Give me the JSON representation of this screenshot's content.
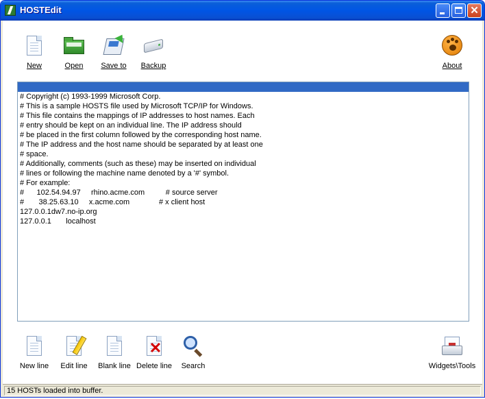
{
  "window": {
    "title": "HOSTEdit"
  },
  "toolbar": {
    "new": {
      "label": "New",
      "icon": "new-file-icon"
    },
    "open": {
      "label": "Open",
      "icon": "open-folder-icon"
    },
    "save_to": {
      "label": "Save to",
      "icon": "save-disk-icon"
    },
    "backup": {
      "label": "Backup",
      "icon": "backup-drive-icon"
    },
    "about": {
      "label": "About",
      "icon": "about-paw-icon"
    }
  },
  "editor": {
    "lines": [
      "",
      "# Copyright (c) 1993-1999 Microsoft Corp.",
      "# This is a sample HOSTS file used by Microsoft TCP/IP for Windows.",
      "# This file contains the mappings of IP addresses to host names. Each",
      "# entry should be kept on an individual line. The IP address should",
      "# be placed in the first column followed by the corresponding host name.",
      "# The IP address and the host name should be separated by at least one",
      "# space.",
      "# Additionally, comments (such as these) may be inserted on individual",
      "# lines or following the machine name denoted by a '#' symbol.",
      "# For example:",
      "#      102.54.94.97     rhino.acme.com          # source server",
      "#       38.25.63.10     x.acme.com              # x client host",
      "127.0.0.1dw7.no-ip.org",
      "127.0.0.1       localhost"
    ]
  },
  "actions": {
    "new_line": "New line",
    "edit_line": "Edit line",
    "blank_line": "Blank line",
    "delete_line": "Delete line",
    "search": "Search",
    "widgets_tools": "Widgets\\Tools"
  },
  "status": {
    "text": "15 HOSTs loaded into buffer."
  },
  "colors": {
    "titlebar": "#0055e5",
    "selection": "#316ac5",
    "close": "#c9401b"
  }
}
